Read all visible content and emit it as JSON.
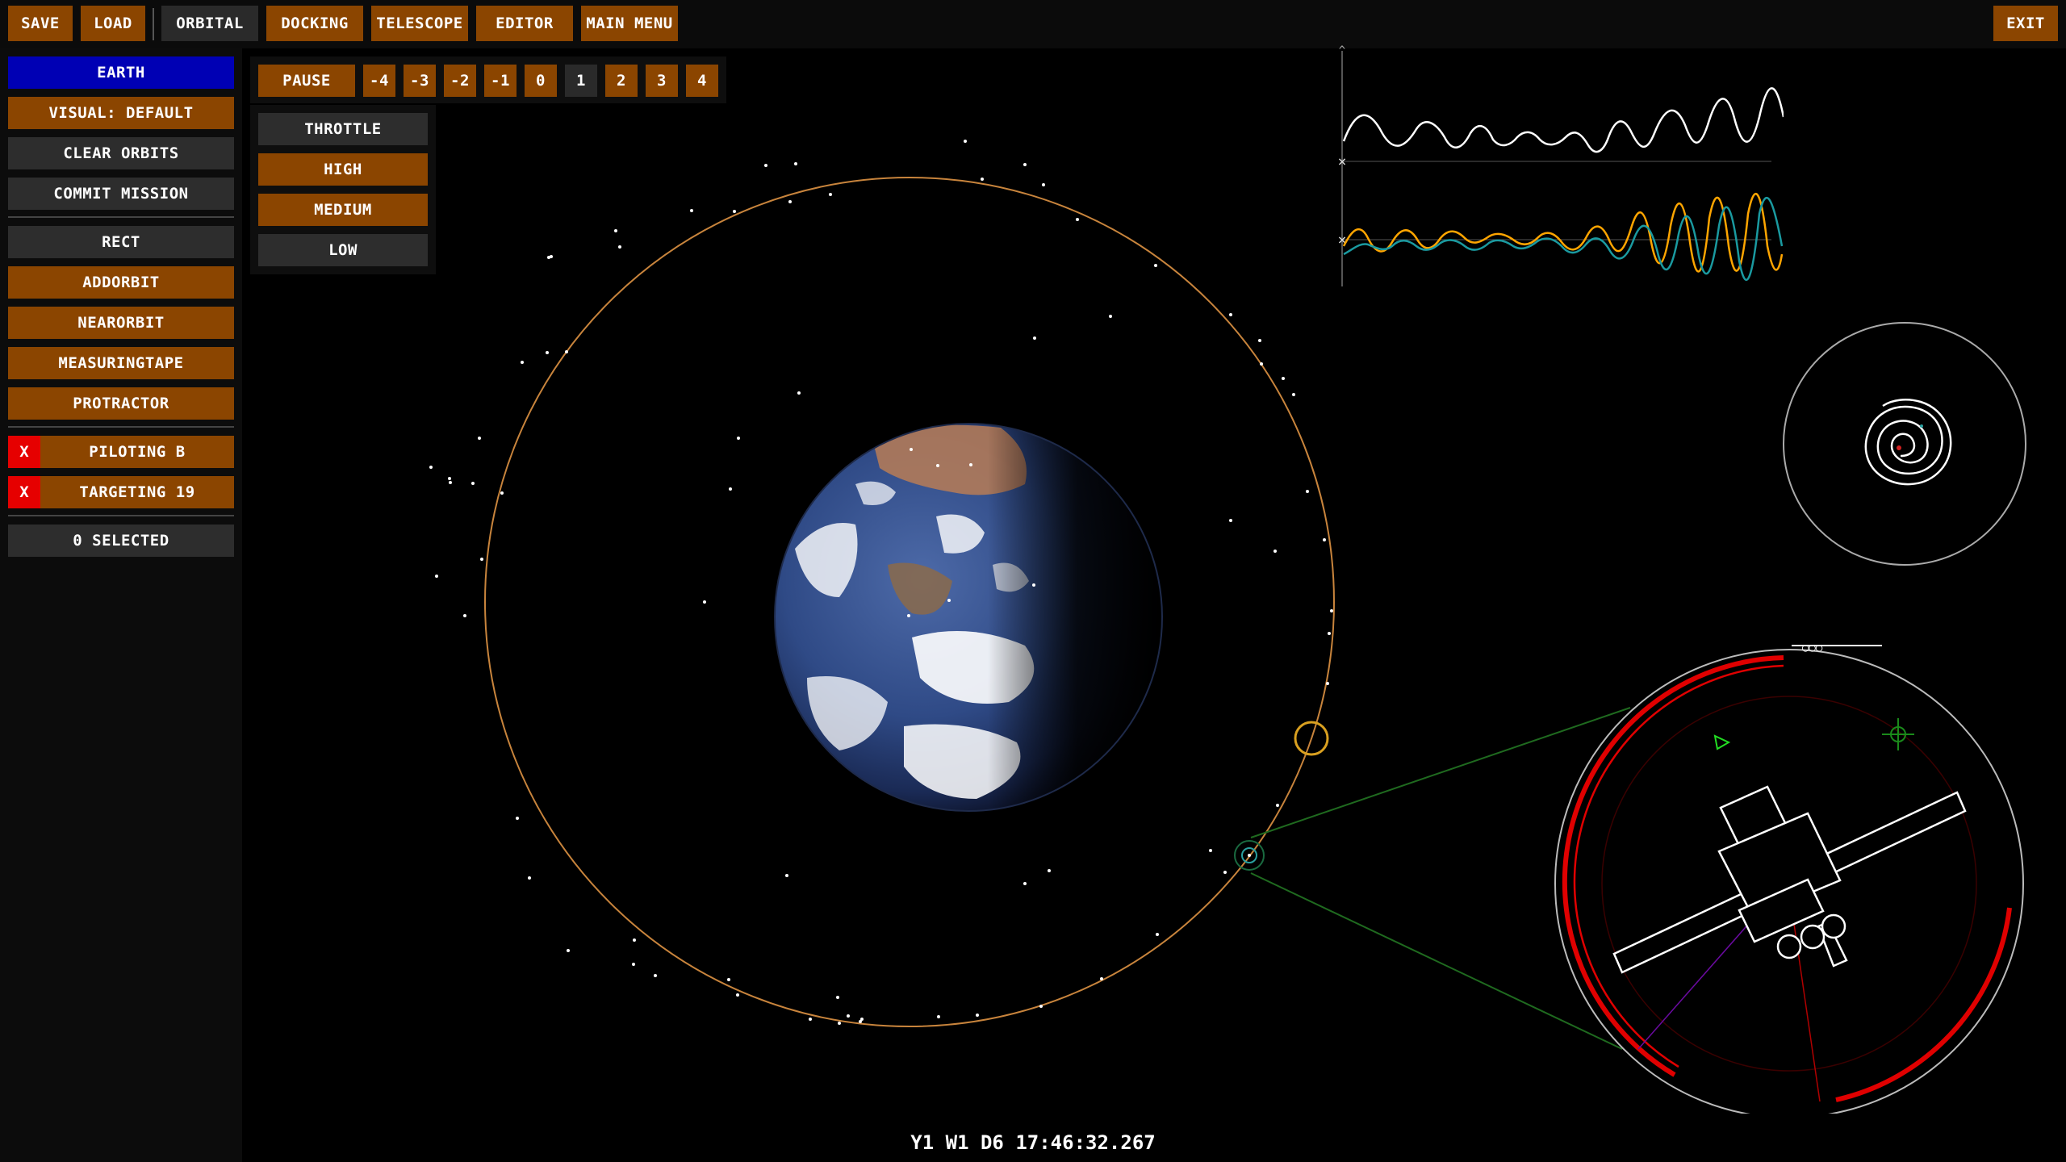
{
  "top_bar": {
    "save": "SAVE",
    "load": "LOAD",
    "tabs": [
      {
        "label": "ORBITAL",
        "active": true
      },
      {
        "label": "DOCKING",
        "active": false
      },
      {
        "label": "TELESCOPE",
        "active": false
      },
      {
        "label": "EDITOR",
        "active": false
      },
      {
        "label": "MAIN MENU",
        "active": false
      }
    ],
    "exit": "EXIT"
  },
  "sidebar": {
    "body_button": "EARTH",
    "visual_button": "VISUAL: DEFAULT",
    "clear_orbits": "CLEAR ORBITS",
    "commit_mission": "COMMIT MISSION",
    "tools": [
      "RECT",
      "ADDORBIT",
      "NEARORBIT",
      "MEASURINGTAPE",
      "PROTRACTOR"
    ],
    "piloting": {
      "close": "X",
      "label": "PILOTING B"
    },
    "targeting": {
      "close": "X",
      "label": "TARGETING 19"
    },
    "selected": "0 SELECTED"
  },
  "time_controls": {
    "pause": "PAUSE",
    "warp_levels": [
      "-4",
      "-3",
      "-2",
      "-1",
      "0",
      "1",
      "2",
      "3",
      "4"
    ],
    "active_warp": "1"
  },
  "throttle": {
    "title": "THROTTLE",
    "options": [
      "HIGH",
      "MEDIUM",
      "LOW"
    ]
  },
  "graph_markers": {
    "up": "^",
    "close": "×"
  },
  "docking_marker": "○○○",
  "clock": "Y1 W1 D6 17:46:32.267",
  "colors": {
    "accent": "#8b4500",
    "gray_button": "#2d2d2d",
    "body_button": "#0000b4",
    "close_red": "#e60000",
    "orbit_line": "#c8843c",
    "graph_orange": "#ffa500",
    "graph_teal": "#1a9aa0",
    "docking_ring": "#e00000"
  }
}
